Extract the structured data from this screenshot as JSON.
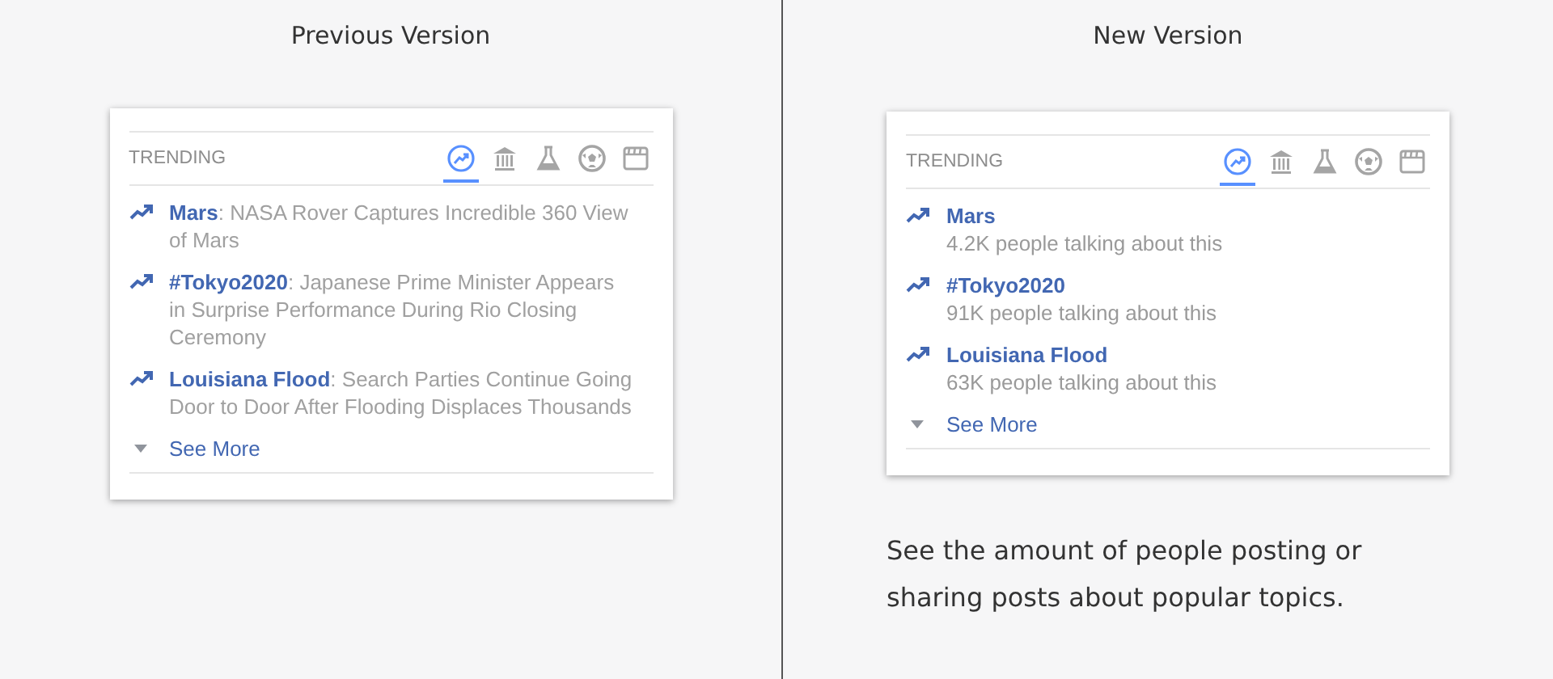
{
  "panels": [
    {
      "title": "Previous Version",
      "card": {
        "header": "TRENDING",
        "tabs": [
          {
            "kind": "trending",
            "selected": true
          },
          {
            "kind": "politics",
            "selected": false
          },
          {
            "kind": "science",
            "selected": false
          },
          {
            "kind": "sports",
            "selected": false
          },
          {
            "kind": "entertainment",
            "selected": false
          }
        ],
        "items": [
          {
            "kind": "headline",
            "text": "**Mars**: NASA Rover Captures Incredible 360 View of Mars"
          },
          {
            "kind": "headline",
            "text": "**#Tokyo2020**: Japanese Prime Minister Appears in Surprise Performance During Rio Closing Ceremony"
          },
          {
            "kind": "headline",
            "text": "**Louisiana Flood**: Search Parties Continue Going Door to Door After Flooding Displaces Thousands"
          }
        ],
        "see_more": "See More"
      }
    },
    {
      "title": "New Version",
      "card": {
        "header": "TRENDING",
        "tabs": [
          {
            "kind": "trending",
            "selected": true
          },
          {
            "kind": "politics",
            "selected": false
          },
          {
            "kind": "science",
            "selected": false
          },
          {
            "kind": "sports",
            "selected": false
          },
          {
            "kind": "entertainment",
            "selected": false
          }
        ],
        "items": [
          {
            "kind": "count",
            "topic": "Mars",
            "count": "4.2K people talking about this"
          },
          {
            "kind": "count",
            "topic": "#Tokyo2020",
            "count": "91K people talking about this"
          },
          {
            "kind": "count",
            "topic": "Louisiana Flood",
            "count": "63K people talking about this"
          }
        ],
        "see_more": "See More"
      },
      "caption": "See the amount of people posting or sharing posts about popular topics."
    }
  ]
}
